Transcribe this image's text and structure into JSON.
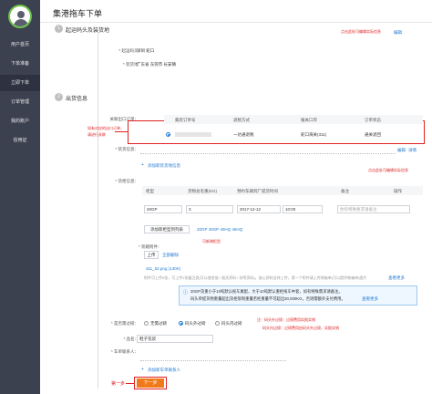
{
  "sidebar": {
    "items": [
      {
        "label": "用户首页"
      },
      {
        "label": "下单准备"
      },
      {
        "label": "立即下单"
      },
      {
        "label": "订单管理"
      },
      {
        "label": "我的账户"
      },
      {
        "label": "信用证"
      }
    ]
  },
  "page": {
    "title": "集港拖车下单"
  },
  "step1": {
    "num": "1",
    "title": "起运码头及装货地",
    "edit_note": "点击此处可编辑实际信息",
    "edit_link": "编辑",
    "origin_port_label": "* 起运码头：",
    "origin_port_value": "深圳 蛇口",
    "loading_place_label": "* 装货地：",
    "loading_place_value": "广东省 东莞市 长安镇"
  },
  "step2": {
    "num": "2",
    "title": "出货信息",
    "related_order_label": "关联出口订单：",
    "related_order_note_1": "如有对应的出口订单，",
    "related_order_note_2": "请进行关联",
    "table_headers": [
      "集装订单号",
      "退税方式",
      "报关口岸",
      "订单状态"
    ],
    "table_row": [
      "",
      "一达通退税",
      "蛇口海关(311)",
      "通关退回"
    ],
    "loading_info_label": "* 装货信息：",
    "loading_info_edit": "编辑",
    "loading_info_detail": "详情",
    "loading_info_note": "点击此处可编辑实际信息",
    "add_loading_info": "添加新装货地信息",
    "container_label": "* 货柜信息：",
    "container_headers": [
      "柜型",
      "货物总毛重(KG)",
      "预约车辆到厂提货时间",
      "备注",
      "操作"
    ],
    "container_type": "20GP",
    "gross_weight": "3",
    "pickup_date": "2017-12-12",
    "pickup_time": "10:00",
    "remark_placeholder": "你有特殊要求请备注",
    "add_container_btn": "添加新柜型到列表",
    "container_options": "20GP 40GP 40HQ 45HQ",
    "add_container_note": "可新增柜型",
    "attachment_label": "* 装箱附件：",
    "upload_btn": "上传",
    "delete_all": "全部删除",
    "file_name": "311_52.png (130K)",
    "attachment_hint": "附件可上传5张，可上传1张备注类(可以使发放 / 报关资料 / 技等资料)，放心资料支持上传，第一个附件请上传装箱单(可以提供装箱单)图片",
    "view_more": "查看更多",
    "notice_line1": "20GP货重小于10吨默认拖车尾配，大于10吨默认重柜拖车中套，如有特殊需求请备注。",
    "notice_line2": "码头单提货物重量超出货柜限制重量若柜重量不可超出30,000KG，否则需额外支付费用。",
    "notice_more": "查看更多",
    "customs_label": "* 是否需过磅：",
    "opt_no": "无需过磅",
    "opt_outside": "码头外过磅",
    "opt_inside": "码头内过磅",
    "customs_note_1": "注：码头外过磅：过磅费用实报实销",
    "customs_note_2": "码头内过磅：过磅费用由码头外过磅，实报实销",
    "product_label": "* 品名：",
    "product_value": "鞋子花袋",
    "contact_label": "* 车单联系人：",
    "add_contact": "添加新车单联系人",
    "first_step_label": "第一步",
    "next_btn": "下一步"
  }
}
